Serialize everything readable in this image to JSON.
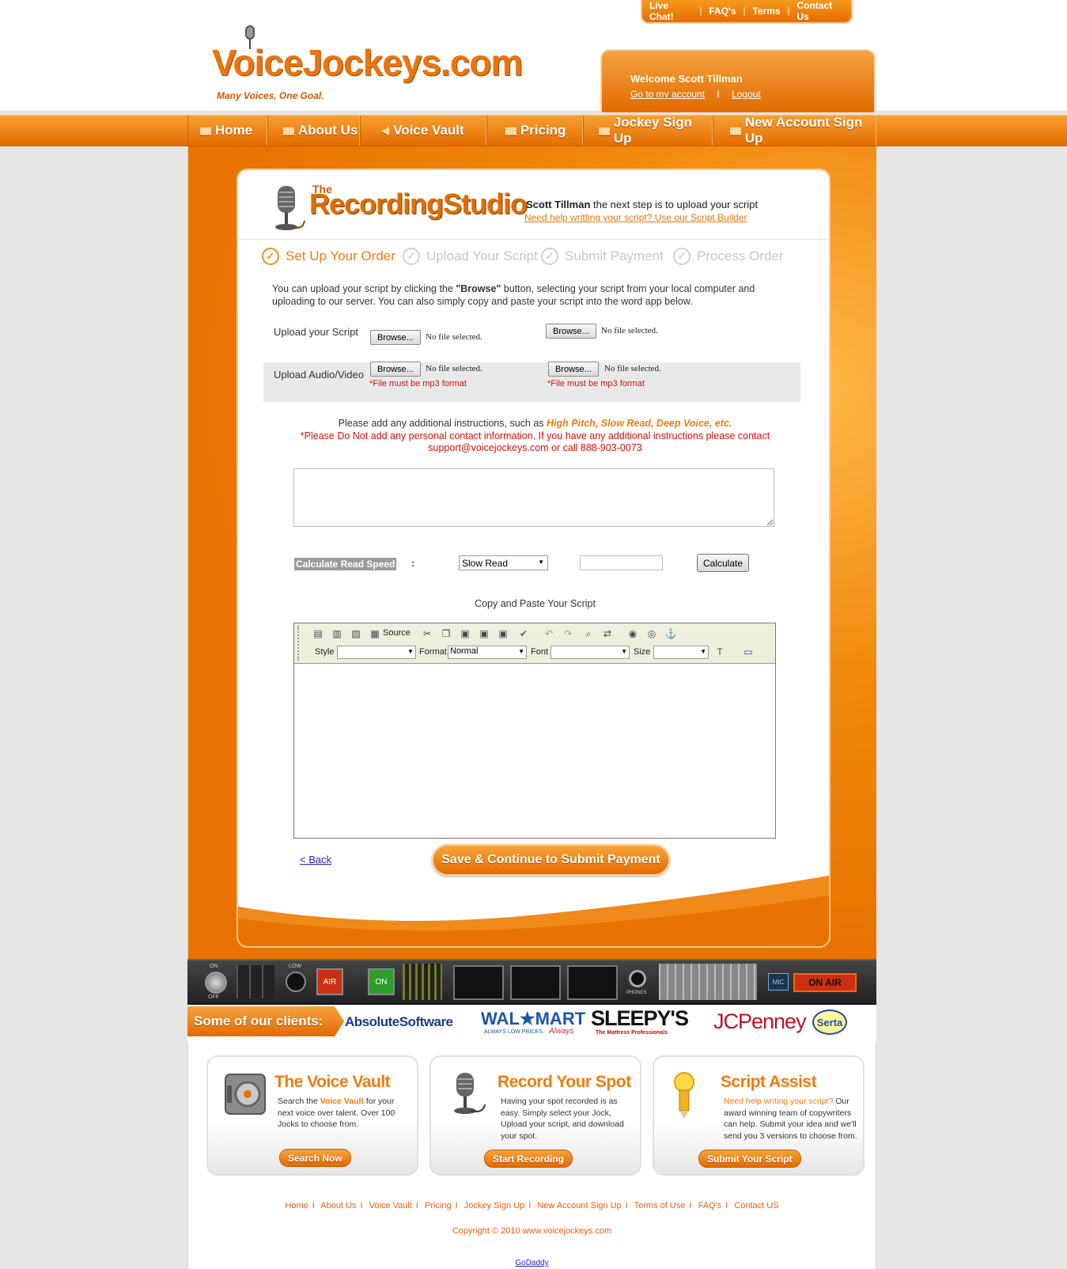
{
  "top_links": [
    "Live Chat!",
    "FAQ's",
    "Terms",
    "Contact Us"
  ],
  "logo": {
    "text": "VoiceJockeys.com",
    "tagline": "Many Voices, One Goal."
  },
  "welcome": {
    "greeting": "Welcome Scott Tillman",
    "account_link": "Go to my account",
    "separator": "I",
    "logout": "Logout"
  },
  "nav": [
    "Home",
    "About Us",
    "Voice Vault",
    "Pricing",
    "Jockey Sign Up",
    "New Account Sign Up"
  ],
  "studio": {
    "the": "The",
    "title": "RecordingStudio",
    "user": "Scott Tillman",
    "message": " the next step is to upload your script",
    "help_link": "Need help writting your script?  Use our Script Builder"
  },
  "steps": [
    {
      "label": "Set Up Your Order",
      "active": true
    },
    {
      "label": "Upload Your Script",
      "active": false
    },
    {
      "label": "Submit Payment",
      "active": false
    },
    {
      "label": "Process Order",
      "active": false
    }
  ],
  "intro": {
    "part1": "You can upload your script by clicking the ",
    "bold": "\"Browse\"",
    "part2": " button, selecting your script from your local computer and uploading to our server. You can also simply copy and paste your script into the word app below."
  },
  "upload": {
    "script_label": "Upload your Script",
    "audio_label": "Upload Audio/Video",
    "browse": "Browse...",
    "no_file": "No file selected.",
    "mp3_note": "*File must be mp3 format"
  },
  "instructions": {
    "line1": "Please add any additional instructions, such as ",
    "highlight": "High Pitch, Slow Read, Deep Voice, etc.",
    "warning": "*Please Do Not add any personal contact information. If you have any additional instructions please contact support@voicejockeys.com or call 888-903-0073"
  },
  "calc": {
    "label": "Calculate Read Speed",
    "colon": ":",
    "select_value": "Slow Read",
    "button": "Calculate"
  },
  "paste_label": "Copy and Paste Your Script",
  "editor": {
    "source": "Source",
    "style_label": "Style",
    "format_label": "Format",
    "format_value": "Normal",
    "font_label": "Font",
    "size_label": "Size"
  },
  "back": "< Back",
  "save_button": "Save & Continue to Submit Payment",
  "console": {
    "on": "ON",
    "off": "OFF",
    "air": "AIR",
    "on_btn": "ON",
    "phones": "PHONES",
    "mic": "MIC",
    "on_air": "ON AIR",
    "low": "LOW"
  },
  "clients_label": "Some of our clients:",
  "clients": [
    "AbsoluteSoftware",
    "WAL★MART",
    "ALWAYS LOW PRICES.",
    "Always",
    "SLEEPY'S",
    "The Mattress Professionals",
    "JCPenney",
    "Serta"
  ],
  "features": [
    {
      "title": "The Voice Vault",
      "text_pre": "Search the ",
      "text_hl": "Voice Vault",
      "text_post": " for your next voice over talent. Over 100 Jocks to choose from.",
      "button": "Search Now"
    },
    {
      "title": "Record Your Spot",
      "text_pre": "Having your spot recorded is as easy. Simply select your Jock, Upload your script, and download your spot.",
      "text_hl": "",
      "text_post": "",
      "button": "Start Recording"
    },
    {
      "title": "Script Assist",
      "text_pre": "",
      "text_hl": "Need help writing your script?",
      "text_post": " Our award winning team of copywriters can help. Submit your idea and we'll send you 3 versions to choose from.",
      "button": "Submit Your Script"
    }
  ],
  "footer_links": [
    "Home",
    "About Us",
    "Voice Vault",
    "Pricing",
    "Jockey Sign Up",
    "New Account Sign Up",
    "Terms of Use",
    "FAQ's",
    "Contact US"
  ],
  "copyright": "Copyright © 2010 www.voicejockeys.com",
  "godaddy": "GoDaddy",
  "colors": {
    "brand_orange": "#ee7b0f",
    "warning_red": "#d3120c",
    "link_blue": "#2222cc"
  }
}
